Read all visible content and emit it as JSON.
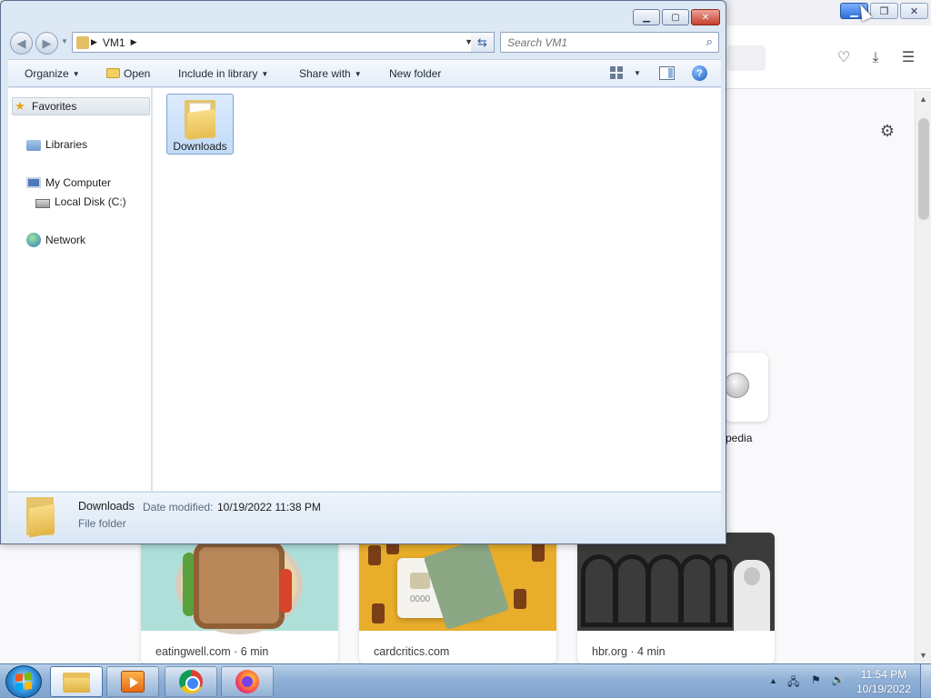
{
  "browser": {
    "shortcut_label": "pedia",
    "stories": [
      {
        "source": "eatingwell.com · 6 min"
      },
      {
        "source": "cardcritics.com"
      },
      {
        "source": "hbr.org · 4 min"
      }
    ],
    "card_digits": "0000",
    "icons": {
      "pocket": "pocket-icon",
      "downloads": "download-icon",
      "menu": "hamburger-menu-icon",
      "settings": "gear-icon"
    }
  },
  "explorer": {
    "address": {
      "crumbs": [
        "VM1"
      ]
    },
    "search": {
      "placeholder": "Search VM1"
    },
    "commands": {
      "organize": "Organize",
      "open": "Open",
      "include_in_library": "Include in library",
      "share_with": "Share with",
      "new_folder": "New folder"
    },
    "navpane": {
      "favorites": "Favorites",
      "libraries": "Libraries",
      "my_computer": "My Computer",
      "local_disk": "Local Disk (C:)",
      "network": "Network"
    },
    "items": [
      {
        "name": "Downloads",
        "selected": true
      }
    ],
    "details": {
      "name": "Downloads",
      "modified_label": "Date modified:",
      "modified_value": "10/19/2022 11:38 PM",
      "type": "File folder"
    }
  },
  "taskbar": {
    "clock_time": "11:54 PM",
    "clock_date": "10/19/2022",
    "apps": [
      "windows-explorer",
      "media-player",
      "google-chrome",
      "firefox"
    ]
  }
}
